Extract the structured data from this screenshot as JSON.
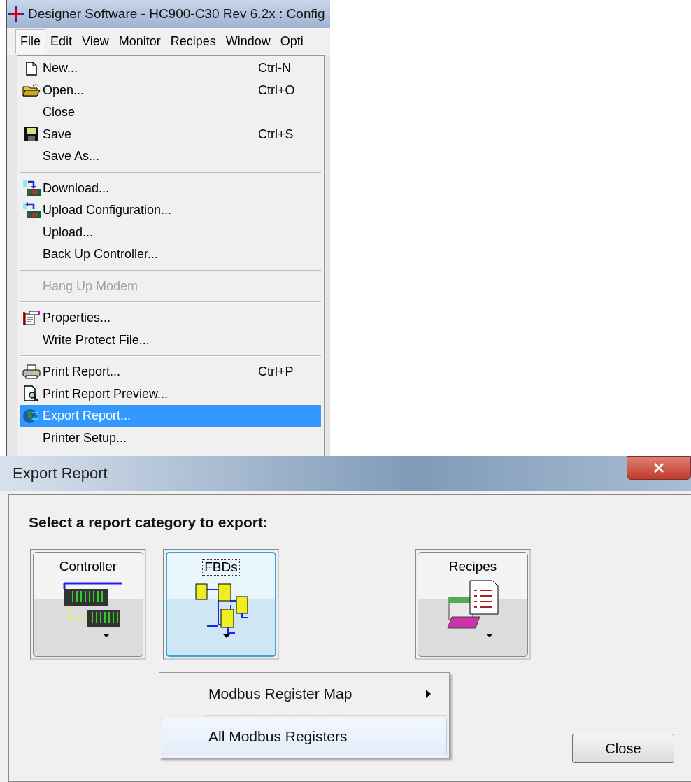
{
  "window": {
    "title": "Designer Software - HC900-C30 Rev 6.2x : Config"
  },
  "menubar": [
    {
      "label": "File",
      "selected": true
    },
    {
      "label": "Edit",
      "selected": false
    },
    {
      "label": "View",
      "selected": false
    },
    {
      "label": "Monitor",
      "selected": false
    },
    {
      "label": "Recipes",
      "selected": false
    },
    {
      "label": "Window",
      "selected": false
    },
    {
      "label": "Opti",
      "selected": false
    }
  ],
  "file_menu": [
    {
      "kind": "item",
      "label": "New...",
      "shortcut": "Ctrl-N",
      "selected": false,
      "disabled": false
    },
    {
      "kind": "item",
      "label": "Open...",
      "shortcut": "Ctrl+O",
      "selected": false,
      "disabled": false
    },
    {
      "kind": "item",
      "label": "Close",
      "selected": false,
      "disabled": false
    },
    {
      "kind": "item",
      "label": "Save",
      "shortcut": "Ctrl+S",
      "selected": false,
      "disabled": false
    },
    {
      "kind": "item",
      "label": "Save As...",
      "selected": false,
      "disabled": false
    },
    {
      "kind": "separator"
    },
    {
      "kind": "item",
      "label": "Download...",
      "selected": false,
      "disabled": false
    },
    {
      "kind": "item",
      "label": "Upload Configuration...",
      "selected": false,
      "disabled": false
    },
    {
      "kind": "item",
      "label": "Upload...",
      "selected": false,
      "disabled": false
    },
    {
      "kind": "item",
      "label": "Back Up Controller...",
      "selected": false,
      "disabled": false
    },
    {
      "kind": "separator"
    },
    {
      "kind": "item",
      "label": "Hang Up Modem",
      "selected": false,
      "disabled": true
    },
    {
      "kind": "separator"
    },
    {
      "kind": "item",
      "label": "Properties...",
      "selected": false,
      "disabled": false
    },
    {
      "kind": "item",
      "label": "Write Protect File...",
      "selected": false,
      "disabled": false
    },
    {
      "kind": "separator"
    },
    {
      "kind": "item",
      "label": "Print Report...",
      "shortcut": "Ctrl+P",
      "selected": false,
      "disabled": false
    },
    {
      "kind": "item",
      "label": "Print Report Preview...",
      "selected": false,
      "disabled": false
    },
    {
      "kind": "item",
      "label": "Export Report...",
      "selected": true,
      "disabled": false
    },
    {
      "kind": "item",
      "label": "Printer Setup...",
      "selected": false,
      "disabled": false
    }
  ],
  "dialog": {
    "title": "Export Report",
    "heading": "Select a report category to export:",
    "categories": [
      {
        "label": "Controller",
        "focused": false
      },
      {
        "label": "FBDs",
        "focused": true
      },
      {
        "label": "Recipes",
        "focused": false
      }
    ],
    "context_menu": [
      {
        "label": "Modbus Register Map",
        "submenu": true,
        "selected": false
      },
      {
        "label": "All Modbus Registers",
        "submenu": false,
        "selected": true
      }
    ],
    "close_button": "Close"
  }
}
